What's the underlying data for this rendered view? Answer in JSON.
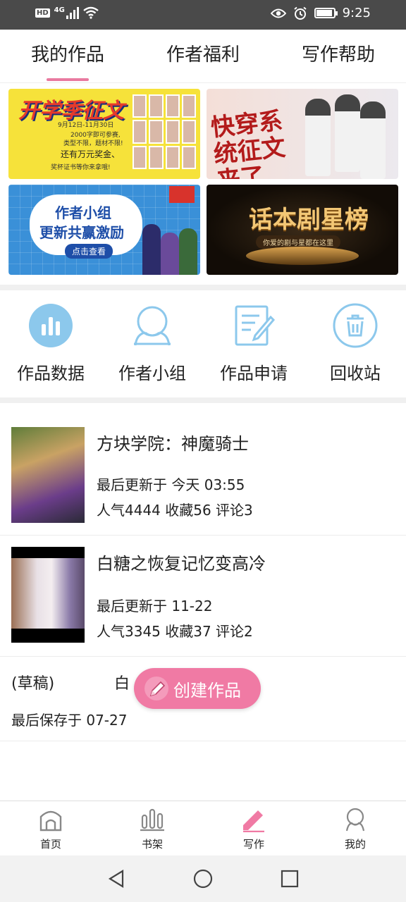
{
  "status_bar": {
    "network": "4G",
    "hd": "HD",
    "time": "9:25"
  },
  "tabs": [
    {
      "label": "我的作品",
      "active": true
    },
    {
      "label": "作者福利",
      "active": false
    },
    {
      "label": "写作帮助",
      "active": false
    }
  ],
  "banners": {
    "b1": {
      "title": "开学季征文",
      "dates": "9月12日-11月30日",
      "line1": "2000字即可参赛,",
      "line2": "类型不限，题材不限!",
      "line3": "还有万元奖金、",
      "line4": "奖杯证书等你来拿哦!"
    },
    "b2": {
      "title": "快穿系统征文来了"
    },
    "b3": {
      "line1": "作者小组",
      "line2": "更新共赢激励",
      "button": "点击查看"
    },
    "b4": {
      "title": "话本剧星榜",
      "subtitle": "你爱的剧与星都在这里"
    }
  },
  "actions": [
    {
      "label": "作品数据",
      "icon": "bar-chart-icon"
    },
    {
      "label": "作者小组",
      "icon": "group-icon"
    },
    {
      "label": "作品申请",
      "icon": "edit-document-icon"
    },
    {
      "label": "回收站",
      "icon": "trash-icon"
    }
  ],
  "works": [
    {
      "title": "方块学院：神魔骑士",
      "updated": "最后更新于 今天 03:55",
      "stats": "人气4444 收藏56 评论3"
    },
    {
      "title": "白糖之恢复记忆变高冷",
      "updated": "最后更新于 11-22",
      "stats": "人气3345 收藏37 评论2"
    }
  ],
  "draft": {
    "label": "(草稿)",
    "title": "白",
    "saved": "最后保存于 07-27"
  },
  "fab": {
    "label": "创建作品"
  },
  "bottom_nav": [
    {
      "label": "首页",
      "active": false
    },
    {
      "label": "书架",
      "active": false
    },
    {
      "label": "写作",
      "active": true
    },
    {
      "label": "我的",
      "active": false
    }
  ],
  "colors": {
    "accent": "#f07aa4",
    "icon_blue": "#8cc8ec",
    "status_bar": "#4a4a4a"
  }
}
